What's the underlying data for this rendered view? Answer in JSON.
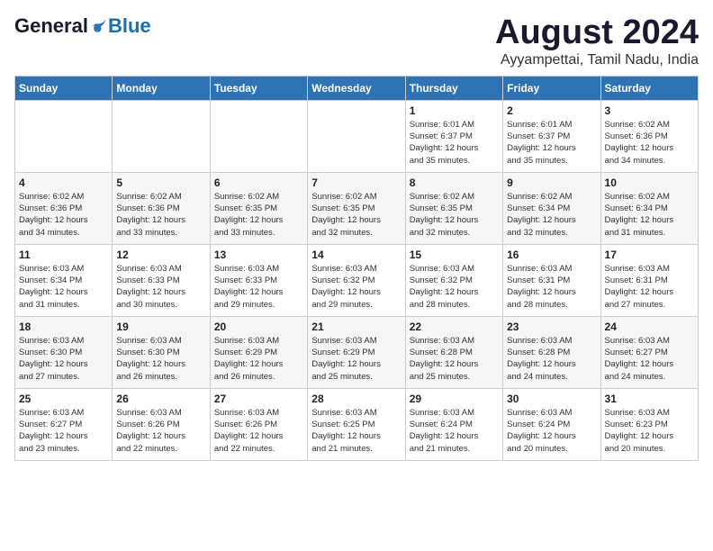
{
  "logo": {
    "general": "General",
    "blue": "Blue"
  },
  "title": "August 2024",
  "subtitle": "Ayyampettai, Tamil Nadu, India",
  "days_of_week": [
    "Sunday",
    "Monday",
    "Tuesday",
    "Wednesday",
    "Thursday",
    "Friday",
    "Saturday"
  ],
  "weeks": [
    [
      {
        "date": "",
        "info": ""
      },
      {
        "date": "",
        "info": ""
      },
      {
        "date": "",
        "info": ""
      },
      {
        "date": "",
        "info": ""
      },
      {
        "date": "1",
        "info": "Sunrise: 6:01 AM\nSunset: 6:37 PM\nDaylight: 12 hours\nand 35 minutes."
      },
      {
        "date": "2",
        "info": "Sunrise: 6:01 AM\nSunset: 6:37 PM\nDaylight: 12 hours\nand 35 minutes."
      },
      {
        "date": "3",
        "info": "Sunrise: 6:02 AM\nSunset: 6:36 PM\nDaylight: 12 hours\nand 34 minutes."
      }
    ],
    [
      {
        "date": "4",
        "info": "Sunrise: 6:02 AM\nSunset: 6:36 PM\nDaylight: 12 hours\nand 34 minutes."
      },
      {
        "date": "5",
        "info": "Sunrise: 6:02 AM\nSunset: 6:36 PM\nDaylight: 12 hours\nand 33 minutes."
      },
      {
        "date": "6",
        "info": "Sunrise: 6:02 AM\nSunset: 6:35 PM\nDaylight: 12 hours\nand 33 minutes."
      },
      {
        "date": "7",
        "info": "Sunrise: 6:02 AM\nSunset: 6:35 PM\nDaylight: 12 hours\nand 32 minutes."
      },
      {
        "date": "8",
        "info": "Sunrise: 6:02 AM\nSunset: 6:35 PM\nDaylight: 12 hours\nand 32 minutes."
      },
      {
        "date": "9",
        "info": "Sunrise: 6:02 AM\nSunset: 6:34 PM\nDaylight: 12 hours\nand 32 minutes."
      },
      {
        "date": "10",
        "info": "Sunrise: 6:02 AM\nSunset: 6:34 PM\nDaylight: 12 hours\nand 31 minutes."
      }
    ],
    [
      {
        "date": "11",
        "info": "Sunrise: 6:03 AM\nSunset: 6:34 PM\nDaylight: 12 hours\nand 31 minutes."
      },
      {
        "date": "12",
        "info": "Sunrise: 6:03 AM\nSunset: 6:33 PM\nDaylight: 12 hours\nand 30 minutes."
      },
      {
        "date": "13",
        "info": "Sunrise: 6:03 AM\nSunset: 6:33 PM\nDaylight: 12 hours\nand 29 minutes."
      },
      {
        "date": "14",
        "info": "Sunrise: 6:03 AM\nSunset: 6:32 PM\nDaylight: 12 hours\nand 29 minutes."
      },
      {
        "date": "15",
        "info": "Sunrise: 6:03 AM\nSunset: 6:32 PM\nDaylight: 12 hours\nand 28 minutes."
      },
      {
        "date": "16",
        "info": "Sunrise: 6:03 AM\nSunset: 6:31 PM\nDaylight: 12 hours\nand 28 minutes."
      },
      {
        "date": "17",
        "info": "Sunrise: 6:03 AM\nSunset: 6:31 PM\nDaylight: 12 hours\nand 27 minutes."
      }
    ],
    [
      {
        "date": "18",
        "info": "Sunrise: 6:03 AM\nSunset: 6:30 PM\nDaylight: 12 hours\nand 27 minutes."
      },
      {
        "date": "19",
        "info": "Sunrise: 6:03 AM\nSunset: 6:30 PM\nDaylight: 12 hours\nand 26 minutes."
      },
      {
        "date": "20",
        "info": "Sunrise: 6:03 AM\nSunset: 6:29 PM\nDaylight: 12 hours\nand 26 minutes."
      },
      {
        "date": "21",
        "info": "Sunrise: 6:03 AM\nSunset: 6:29 PM\nDaylight: 12 hours\nand 25 minutes."
      },
      {
        "date": "22",
        "info": "Sunrise: 6:03 AM\nSunset: 6:28 PM\nDaylight: 12 hours\nand 25 minutes."
      },
      {
        "date": "23",
        "info": "Sunrise: 6:03 AM\nSunset: 6:28 PM\nDaylight: 12 hours\nand 24 minutes."
      },
      {
        "date": "24",
        "info": "Sunrise: 6:03 AM\nSunset: 6:27 PM\nDaylight: 12 hours\nand 24 minutes."
      }
    ],
    [
      {
        "date": "25",
        "info": "Sunrise: 6:03 AM\nSunset: 6:27 PM\nDaylight: 12 hours\nand 23 minutes."
      },
      {
        "date": "26",
        "info": "Sunrise: 6:03 AM\nSunset: 6:26 PM\nDaylight: 12 hours\nand 22 minutes."
      },
      {
        "date": "27",
        "info": "Sunrise: 6:03 AM\nSunset: 6:26 PM\nDaylight: 12 hours\nand 22 minutes."
      },
      {
        "date": "28",
        "info": "Sunrise: 6:03 AM\nSunset: 6:25 PM\nDaylight: 12 hours\nand 21 minutes."
      },
      {
        "date": "29",
        "info": "Sunrise: 6:03 AM\nSunset: 6:24 PM\nDaylight: 12 hours\nand 21 minutes."
      },
      {
        "date": "30",
        "info": "Sunrise: 6:03 AM\nSunset: 6:24 PM\nDaylight: 12 hours\nand 20 minutes."
      },
      {
        "date": "31",
        "info": "Sunrise: 6:03 AM\nSunset: 6:23 PM\nDaylight: 12 hours\nand 20 minutes."
      }
    ]
  ]
}
